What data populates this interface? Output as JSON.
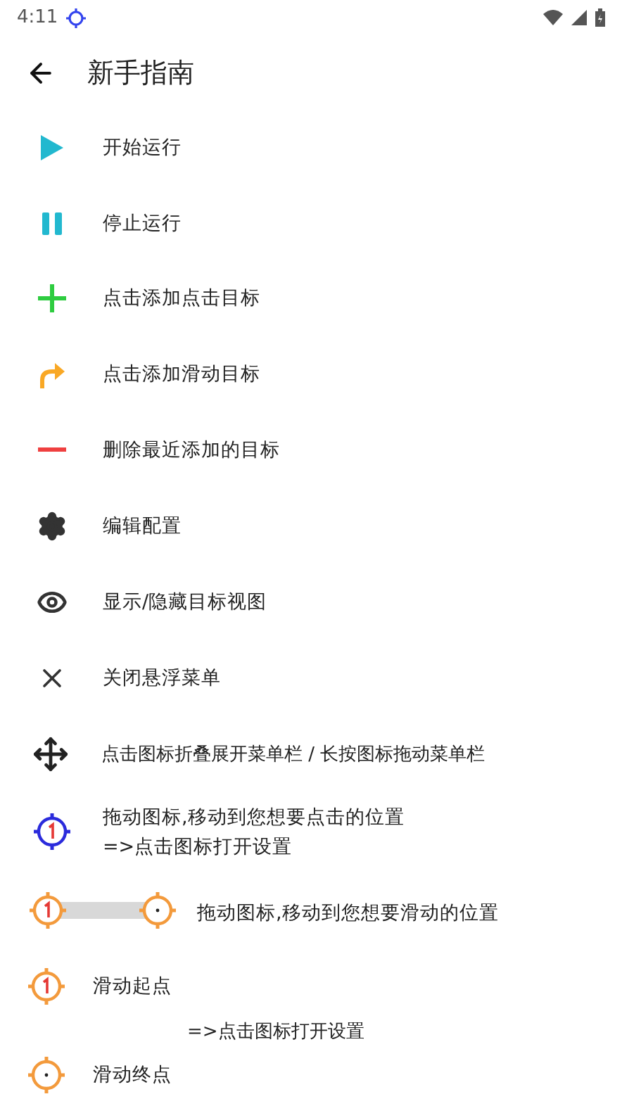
{
  "status_bar": {
    "time": "4:11"
  },
  "toolbar": {
    "title": "新手指南"
  },
  "rows": [
    {
      "kind": "play",
      "lines": [
        "开始运行"
      ]
    },
    {
      "kind": "pause",
      "lines": [
        "停止运行"
      ]
    },
    {
      "kind": "plus",
      "lines": [
        "点击添加点击目标"
      ]
    },
    {
      "kind": "swipe_arrow",
      "lines": [
        "点击添加滑动目标"
      ]
    },
    {
      "kind": "minus",
      "lines": [
        "删除最近添加的目标"
      ]
    },
    {
      "kind": "gear",
      "lines": [
        "编辑配置"
      ]
    },
    {
      "kind": "eye",
      "lines": [
        "显示/隐藏目标视图"
      ]
    },
    {
      "kind": "close",
      "lines": [
        "关闭悬浮菜单"
      ]
    },
    {
      "kind": "move",
      "lines": [
        "点击图标折叠展开菜单栏 / 长按图标拖动菜单栏"
      ]
    },
    {
      "kind": "click_target",
      "lines": [
        "拖动图标,移动到您想要点击的位置",
        "=>点击图标打开设置"
      ]
    },
    {
      "kind": "swipe_pair",
      "lines": [
        "拖动图标,移动到您想要滑动的位置"
      ]
    },
    {
      "kind": "swipe_start",
      "lines": [
        "滑动起点"
      ]
    },
    {
      "kind": "note",
      "lines": [
        "=>点击图标打开设置"
      ]
    },
    {
      "kind": "swipe_end",
      "lines": [
        "滑动终点"
      ]
    }
  ]
}
